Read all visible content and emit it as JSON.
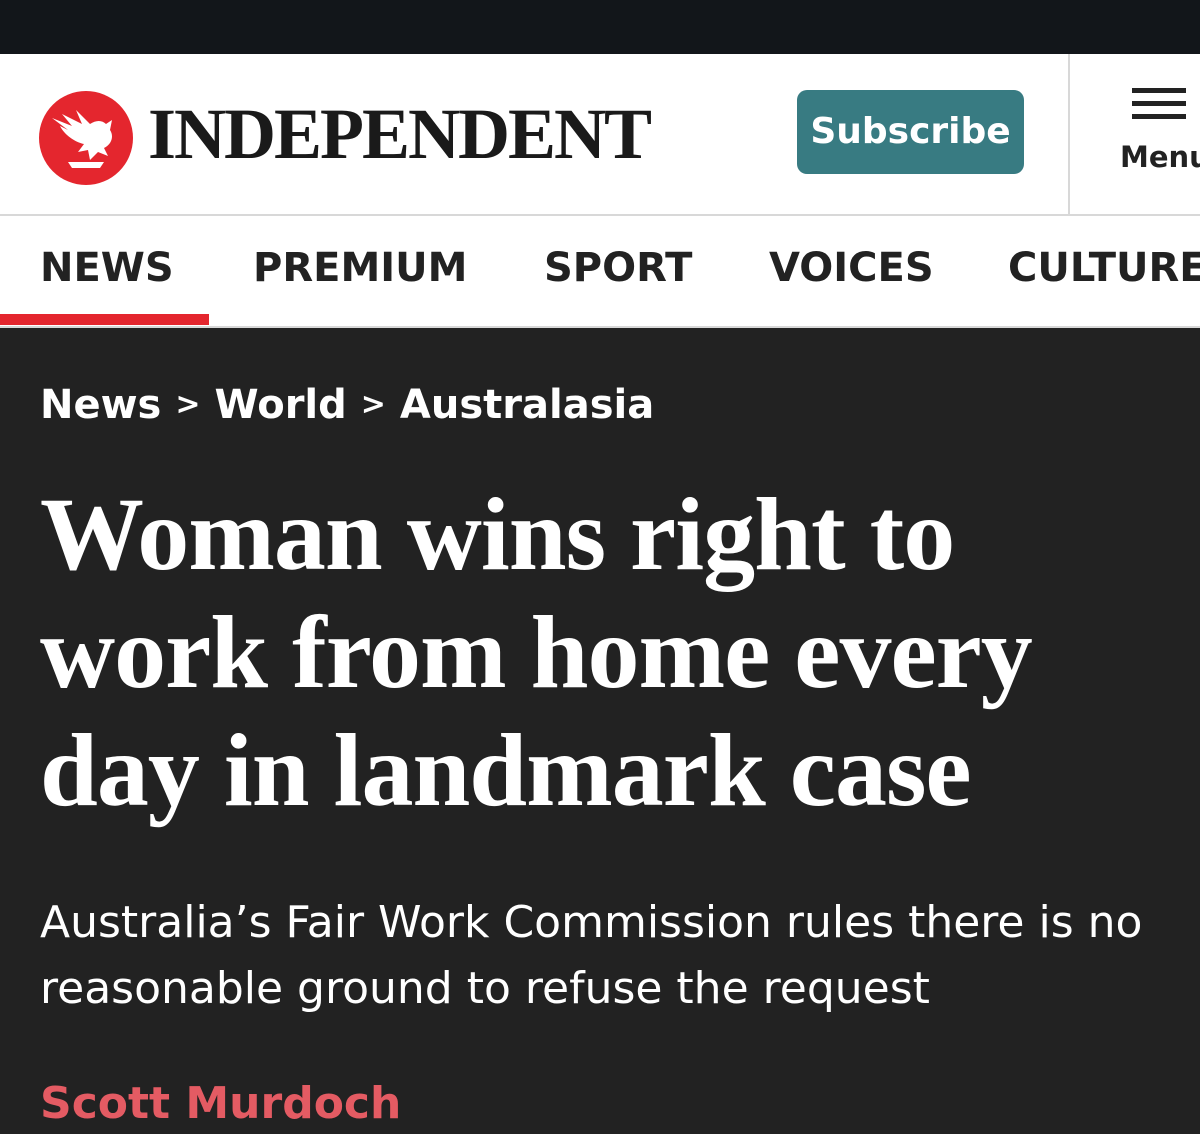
{
  "header": {
    "brand_name": "INDEPENDENT",
    "subscribe_label": "Subscribe",
    "menu_label": "Menu"
  },
  "nav": {
    "items": [
      "NEWS",
      "PREMIUM",
      "SPORT",
      "VOICES",
      "CULTURE"
    ],
    "active": "NEWS"
  },
  "breadcrumb": {
    "items": [
      "News",
      "World",
      "Australasia"
    ],
    "separator": ">"
  },
  "article": {
    "headline": "Woman wins right to work from home every day in landmark case",
    "standfirst": "Australia’s Fair Work Commission rules there is no reasonable ground to refuse the request",
    "author": "Scott Murdoch"
  },
  "colors": {
    "brand_red": "#e4262e",
    "subscribe_teal": "#387b82",
    "article_background": "#222222",
    "byline_red": "#e45b63"
  },
  "icons": {
    "logo": "eagle-logo-icon",
    "menu": "hamburger-menu-icon"
  }
}
